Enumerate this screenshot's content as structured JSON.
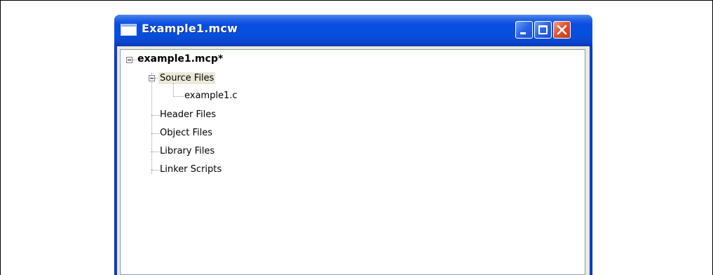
{
  "window": {
    "title": "Example1.mcw"
  },
  "tree": {
    "root": {
      "label": "example1.mcp*",
      "expanded": true
    },
    "folders": [
      {
        "label": "Source Files",
        "expanded": true,
        "selected": true,
        "children": [
          "example1.c"
        ]
      },
      {
        "label": "Header Files"
      },
      {
        "label": "Object Files"
      },
      {
        "label": "Library Files"
      },
      {
        "label": "Linker Scripts"
      }
    ]
  },
  "icons": {
    "app": "window-app-icon",
    "minimize": "minimize-icon",
    "maximize": "maximize-icon",
    "close": "close-icon",
    "expander": "collapse-minus-icon"
  },
  "colors": {
    "titlebar": "#0a4ce0",
    "close_button": "#e0552f",
    "selection": "#ece9d8",
    "panel_border": "#7f9db9"
  }
}
